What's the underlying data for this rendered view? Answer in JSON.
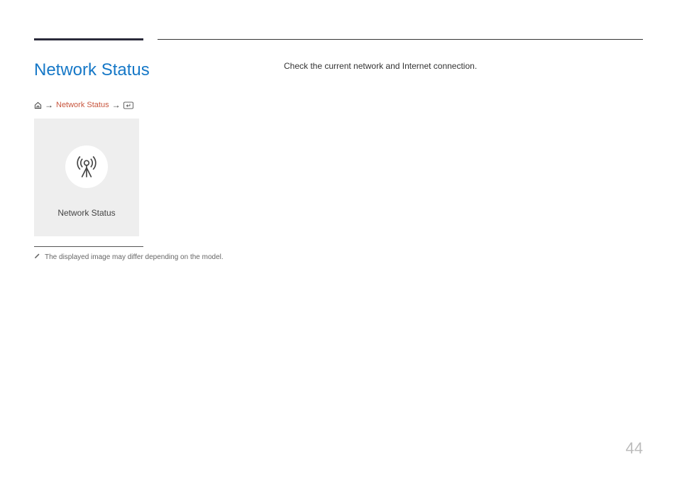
{
  "page_title": "Network Status",
  "breadcrumb": {
    "link_label": "Network Status"
  },
  "card": {
    "label": "Network Status"
  },
  "note": "The displayed image may differ depending on the model.",
  "description": "Check the current network and Internet connection.",
  "page_number": "44"
}
